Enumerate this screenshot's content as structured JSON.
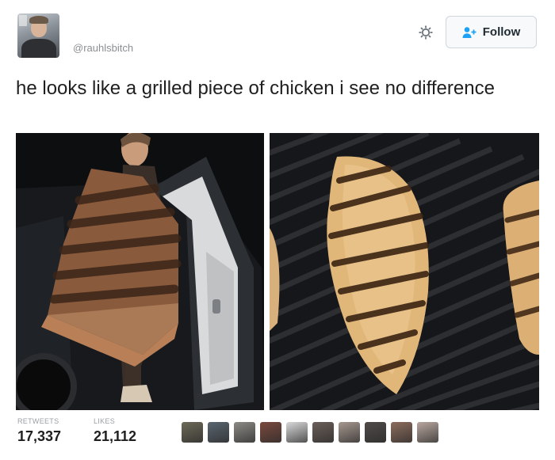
{
  "author": {
    "handle": "@rauhlsbitch"
  },
  "actions": {
    "follow_label": "Follow"
  },
  "tweet": {
    "text": "he looks like a grilled piece of chicken i see no difference"
  },
  "stats": {
    "retweets_label": "RETWEETS",
    "retweets_count": "17,337",
    "likes_label": "LIKES",
    "likes_count": "21,112"
  },
  "likers": [
    "#6d6a58",
    "#5a6670",
    "#8c8a85",
    "#7a4a3e",
    "#d9d9d9",
    "#6b5f59",
    "#a6988f",
    "#4f4b49",
    "#8d6d5d",
    "#b9a79f"
  ],
  "colors": {
    "follow_blue": "#1da1f2"
  }
}
